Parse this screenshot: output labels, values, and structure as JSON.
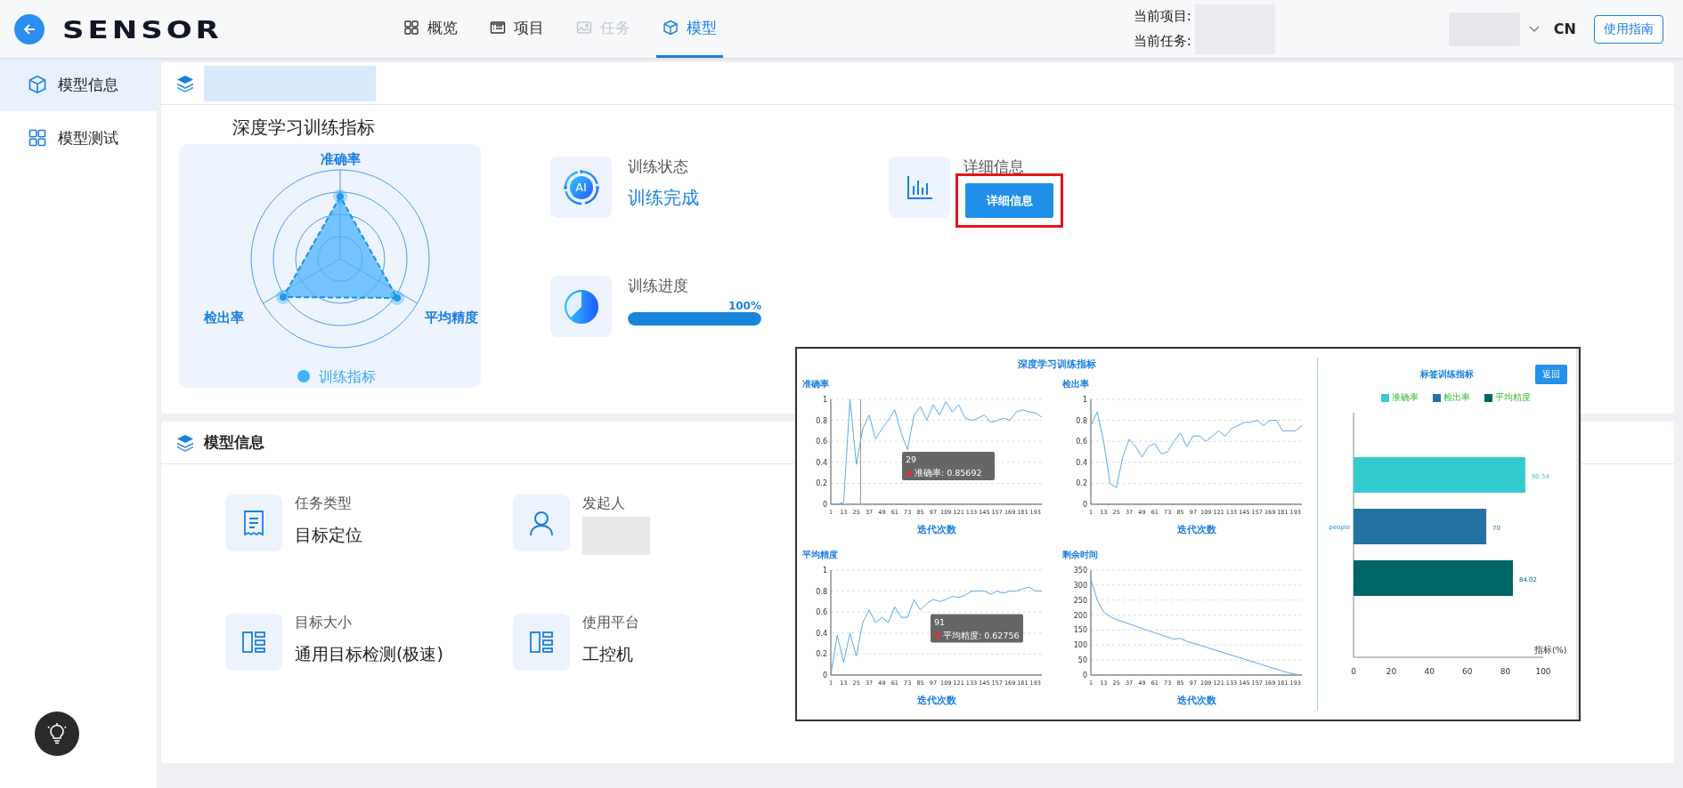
{
  "header": {
    "logo": "SENSOR",
    "nav": [
      {
        "label": "概览",
        "selected": false,
        "disabled": false
      },
      {
        "label": "项目",
        "selected": false,
        "disabled": false
      },
      {
        "label": "任务",
        "selected": false,
        "disabled": true
      },
      {
        "label": "模型",
        "selected": true,
        "disabled": false
      }
    ],
    "project_label": "当前项目:",
    "task_label": "当前任务:",
    "language": "CN",
    "guide_button": "使用指南"
  },
  "sidebar": {
    "items": [
      {
        "label": "模型信息",
        "selected": true
      },
      {
        "label": "模型测试",
        "selected": false
      }
    ]
  },
  "training_card": {
    "chart_title": "深度学习训练指标",
    "radar": {
      "axes": [
        "准确率",
        "检出率",
        "平均精度"
      ],
      "legend": "训练指标"
    },
    "status": {
      "label": "训练状态",
      "icon_text": "AI",
      "value": "训练完成"
    },
    "progress": {
      "label": "训练进度",
      "reading": "100%",
      "level": 1
    },
    "details": {
      "label": "详细信息",
      "button": "详细信息",
      "highlighted": true
    }
  },
  "model_card": {
    "title": "模型信息",
    "fields": [
      {
        "label": "任务类型",
        "kind": "text",
        "value": "目标定位"
      },
      {
        "label": "发起人",
        "kind": "redacted"
      },
      {
        "label": "目标大小",
        "kind": "text",
        "value": "通用目标检测(极速)"
      },
      {
        "label": "使用平台",
        "kind": "text",
        "value": "工控机"
      }
    ]
  },
  "overlay": {
    "title": "深度学习训练指标",
    "charts": [
      {
        "chart_data": {
          "type": "line",
          "title": "准确率",
          "xlabel": "迭代次数",
          "grid": true,
          "x": [
            1,
            7,
            13,
            19,
            25,
            31,
            37,
            43,
            49,
            55,
            61,
            67,
            73,
            79,
            85,
            91,
            97,
            103,
            109,
            115,
            121,
            127,
            133,
            139,
            145,
            151,
            157,
            163,
            169,
            175,
            181,
            187,
            193,
            199
          ],
          "xlim": [
            1,
            199
          ],
          "ylim": [
            0,
            1
          ],
          "xticks": [
            1,
            13,
            25,
            37,
            49,
            61,
            73,
            85,
            97,
            109,
            121,
            133,
            145,
            157,
            169,
            181,
            193
          ],
          "yticks": [
            0,
            0.2,
            0.4,
            0.6,
            0.8,
            1
          ],
          "values": [
            0,
            0,
            0.02,
            1,
            0.38,
            0.72,
            0.85,
            0.62,
            0.72,
            0.8,
            0.9,
            0.68,
            0.52,
            0.85,
            0.93,
            0.8,
            0.95,
            0.85,
            0.98,
            0.88,
            0.95,
            0.82,
            0.8,
            0.82,
            0.85,
            0.78,
            0.8,
            0.82,
            0.8,
            0.88,
            0.9,
            0.88,
            0.87,
            0.83
          ],
          "ref_lines": [
            {
              "axis": "x",
              "value": 29
            }
          ],
          "annotations": [
            "29",
            "准确率: 0.85692"
          ]
        }
      },
      {
        "chart_data": {
          "type": "line",
          "title": "检出率",
          "xlabel": "迭代次数",
          "grid": true,
          "x": [
            1,
            7,
            13,
            19,
            25,
            31,
            37,
            43,
            49,
            55,
            61,
            67,
            73,
            79,
            85,
            91,
            97,
            103,
            109,
            115,
            121,
            127,
            133,
            139,
            145,
            151,
            157,
            163,
            169,
            175,
            181,
            187,
            193,
            199
          ],
          "xlim": [
            1,
            199
          ],
          "ylim": [
            0,
            1
          ],
          "xticks": [
            1,
            13,
            25,
            37,
            49,
            61,
            73,
            85,
            97,
            109,
            121,
            133,
            145,
            157,
            169,
            181,
            193
          ],
          "yticks": [
            0,
            0.2,
            0.4,
            0.6,
            0.8,
            1
          ],
          "values": [
            0.75,
            0.88,
            0.6,
            0.2,
            0.16,
            0.45,
            0.62,
            0.55,
            0.45,
            0.55,
            0.58,
            0.48,
            0.5,
            0.6,
            0.68,
            0.55,
            0.65,
            0.65,
            0.6,
            0.65,
            0.7,
            0.65,
            0.72,
            0.75,
            0.78,
            0.78,
            0.8,
            0.75,
            0.8,
            0.8,
            0.7,
            0.7,
            0.7,
            0.75
          ]
        }
      },
      {
        "chart_data": {
          "type": "line",
          "title": "平均精度",
          "xlabel": "迭代次数",
          "grid": true,
          "x": [
            1,
            7,
            13,
            19,
            25,
            31,
            37,
            43,
            49,
            55,
            61,
            67,
            73,
            79,
            85,
            91,
            97,
            103,
            109,
            115,
            121,
            127,
            133,
            139,
            145,
            151,
            157,
            163,
            169,
            175,
            181,
            187,
            193,
            199
          ],
          "xlim": [
            1,
            199
          ],
          "ylim": [
            0,
            1
          ],
          "xticks": [
            1,
            13,
            25,
            37,
            49,
            61,
            73,
            85,
            97,
            109,
            121,
            133,
            145,
            157,
            169,
            181,
            193
          ],
          "yticks": [
            0,
            0.2,
            0.4,
            0.6,
            0.8,
            1
          ],
          "values": [
            0,
            0.38,
            0.12,
            0.4,
            0.18,
            0.5,
            0.62,
            0.5,
            0.55,
            0.5,
            0.65,
            0.55,
            0.55,
            0.72,
            0.62,
            0.68,
            0.72,
            0.7,
            0.72,
            0.75,
            0.74,
            0.76,
            0.8,
            0.8,
            0.8,
            0.77,
            0.8,
            0.78,
            0.8,
            0.8,
            0.82,
            0.84,
            0.8,
            0.8
          ],
          "annotations": [
            "91",
            "平均精度: 0.62756"
          ]
        }
      },
      {
        "chart_data": {
          "type": "line",
          "title": "剩余时间",
          "xlabel": "迭代次数",
          "grid": true,
          "x": [
            1,
            7,
            13,
            19,
            25,
            31,
            37,
            43,
            49,
            55,
            61,
            67,
            73,
            79,
            85,
            91,
            97,
            103,
            109,
            115,
            121,
            127,
            133,
            139,
            145,
            151,
            157,
            163,
            169,
            175,
            181,
            187,
            193,
            199
          ],
          "xlim": [
            1,
            199
          ],
          "ylim": [
            0,
            350
          ],
          "xticks": [
            1,
            13,
            25,
            37,
            49,
            61,
            73,
            85,
            97,
            109,
            121,
            133,
            145,
            157,
            169,
            181,
            193
          ],
          "yticks": [
            0,
            50,
            100,
            150,
            200,
            250,
            300,
            350
          ],
          "values": [
            320,
            250,
            210,
            195,
            185,
            178,
            170,
            163,
            155,
            148,
            141,
            134,
            127,
            120,
            122,
            113,
            106,
            100,
            93,
            86,
            80,
            73,
            66,
            60,
            53,
            46,
            40,
            33,
            26,
            20,
            13,
            7,
            3,
            0
          ]
        }
      }
    ],
    "label_panel": {
      "back_button": "返回",
      "chart_data": {
        "type": "bar",
        "orientation": "horizontal",
        "title": "标签训练指标",
        "xlabel": "指标(%)",
        "legend": "top",
        "categories": [
          "people"
        ],
        "xlim": [
          0,
          100
        ],
        "xticks": [
          0,
          20,
          40,
          60,
          80,
          100
        ],
        "data_labels": true,
        "series": [
          {
            "name": "准确率",
            "color": "#33cccc",
            "values": [
              90.54
            ]
          },
          {
            "name": "检出率",
            "color": "#2471a3",
            "values": [
              70
            ]
          },
          {
            "name": "平均精度",
            "color": "#006663",
            "values": [
              84.02
            ]
          }
        ]
      }
    }
  }
}
